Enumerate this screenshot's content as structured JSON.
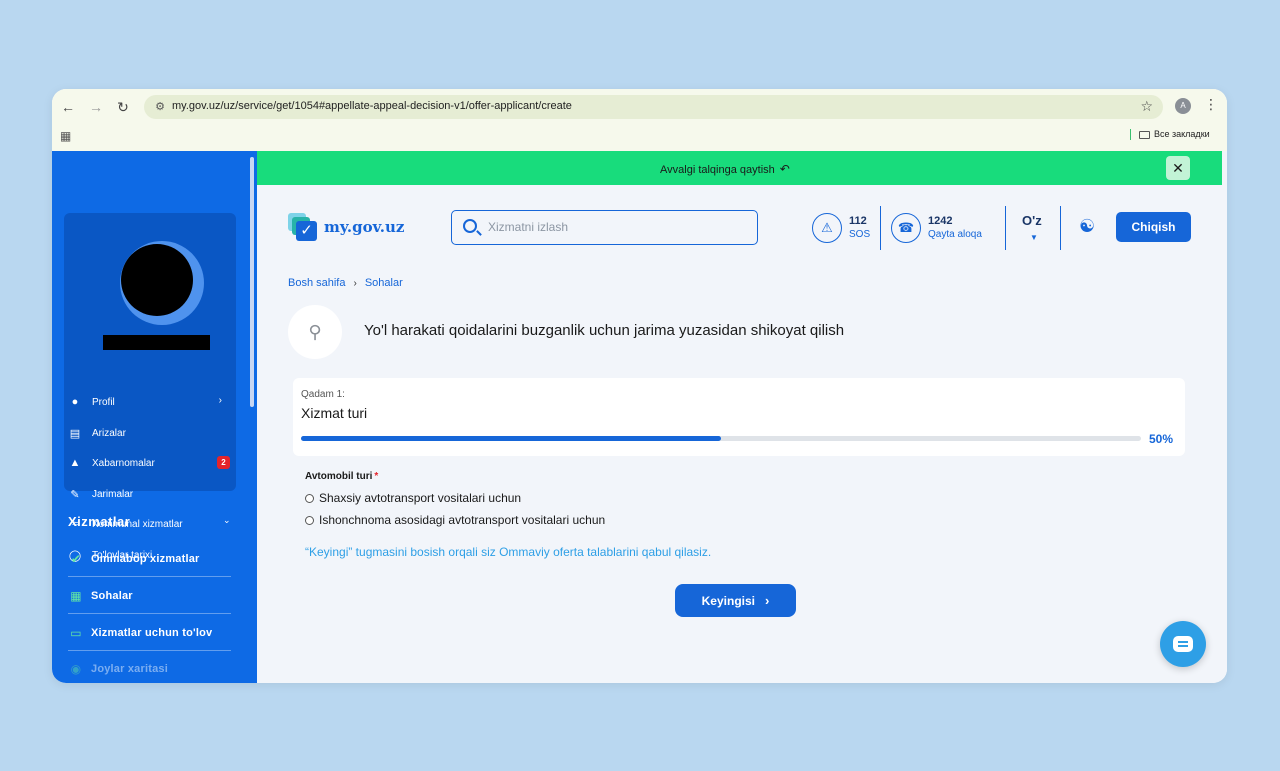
{
  "browser": {
    "url": "my.gov.uz/uz/service/get/1054#appellate-appeal-decision-v1/offer-applicant/create",
    "profile_initial": "A",
    "bookmarks_label": "Все закладки"
  },
  "sidebar": {
    "menu": [
      {
        "label": "Profil",
        "icon": "user-icon"
      },
      {
        "label": "Arizalar",
        "icon": "document-icon"
      },
      {
        "label": "Xabarnomalar",
        "icon": "bell-icon",
        "badge": "2"
      },
      {
        "label": "Jarimalar",
        "icon": "fine-icon"
      },
      {
        "label": "Kommunal xizmatlar",
        "icon": "utility-icon"
      },
      {
        "label": "To'lovlar tarixi",
        "icon": "money-bag-icon"
      }
    ],
    "section_title": "Xizmatlar",
    "section_items": [
      {
        "label": "Ommabop xizmatlar",
        "icon": "check-badge-icon"
      },
      {
        "label": "Sohalar",
        "icon": "grid-icon"
      },
      {
        "label": "Xizmatlar uchun to'lov",
        "icon": "card-icon"
      },
      {
        "label": "Joylar xaritasi",
        "icon": "location-icon"
      }
    ]
  },
  "banner": {
    "text": "Avvalgi talqinga qaytish"
  },
  "header": {
    "logo_text": "my.gov.uz",
    "search_placeholder": "Xizmatni izlash",
    "sos_number": "112",
    "sos_label": "SOS",
    "callback_number": "1242",
    "callback_label": "Qayta aloqa",
    "language": "O'z",
    "exit_label": "Chiqish"
  },
  "breadcrumb": {
    "home": "Bosh sahifa",
    "current": "Sohalar"
  },
  "service": {
    "title": "Yo'l harakati qoidalarini buzganlik uchun jarima yuzasidan shikoyat qilish"
  },
  "step": {
    "number_label": "Qadam 1:",
    "name": "Xizmat turi",
    "progress": 0.5,
    "progress_label": "50%"
  },
  "form": {
    "field_label": "Avtomobil turi",
    "required_mark": "*",
    "options": [
      "Shaxsiy avtotransport vositalari uchun",
      "Ishonchnoma asosidagi avtotransport vositalari uchun"
    ],
    "notice": "“Keyingi” tugmasini bosish orqali siz Ommaviy oferta talablarini qabul qilasiz.",
    "next_label": "Keyingisi"
  },
  "colors": {
    "primary": "#1666d8",
    "sidebar": "#0e6ae5",
    "banner": "#18dc7c",
    "link": "#2e9fe6",
    "badge": "#e4242b"
  }
}
